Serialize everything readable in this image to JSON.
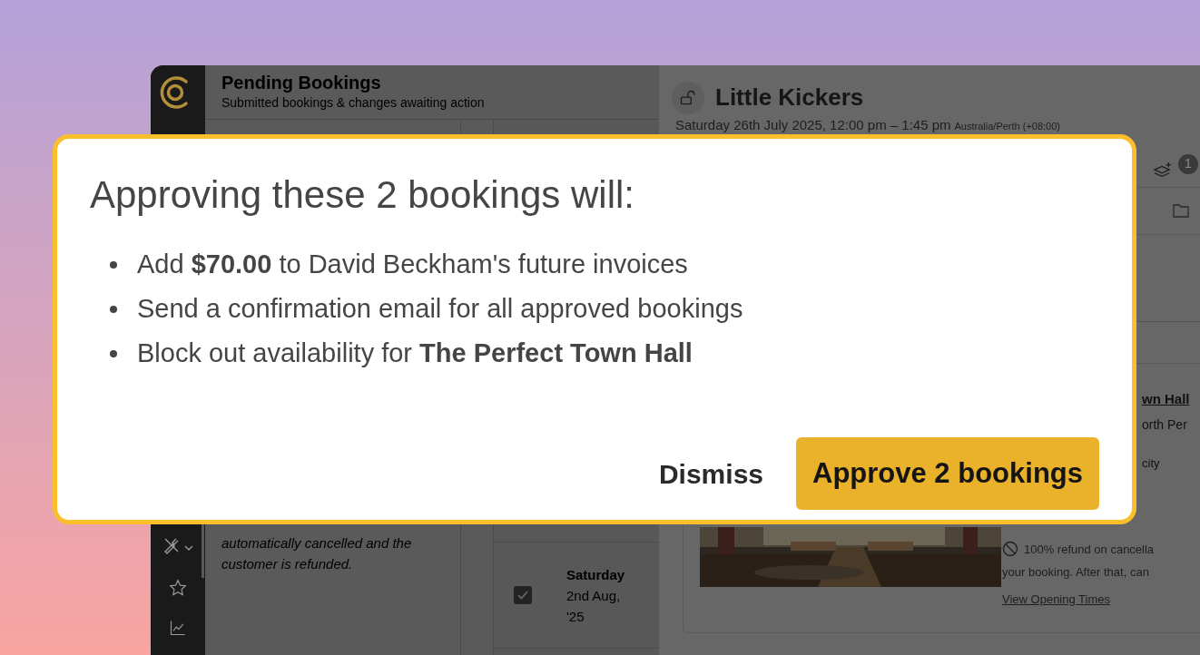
{
  "left_panel": {
    "title": "Pending Bookings",
    "subtitle": "Submitted bookings & changes awaiting action",
    "note_lines": [
      "automatically cancelled and the",
      "customer is refunded."
    ]
  },
  "bookings_table": {
    "rows": [
      {
        "checked": true,
        "day": "Saturday",
        "date": "2nd Aug,",
        "year": "'25"
      }
    ]
  },
  "detail": {
    "title": "Little Kickers",
    "date_time": "Saturday 26th July 2025, 12:00 pm – 1:45 pm",
    "timezone": "Australia/Perth (+08:00)",
    "badge": "1",
    "venue_name": "wn Hall",
    "venue_address": "orth Per",
    "capacity": "city",
    "refund_policy": "100% refund on cancella",
    "refund_policy_2": "your booking. After that, can",
    "opening_times_link": "View Opening Times"
  },
  "dialog": {
    "title": "Approving these 2 bookings will:",
    "items": [
      "Add **$70.00** to David Beckham's future invoices",
      "Send a confirmation email for all approved bookings",
      "Block out availability for **The Perfect Town Hall**"
    ],
    "buttons": [
      {
        "label": "Dismiss",
        "kind": "secondary"
      },
      {
        "label": "Approve 2 bookings",
        "kind": "primary"
      }
    ]
  }
}
